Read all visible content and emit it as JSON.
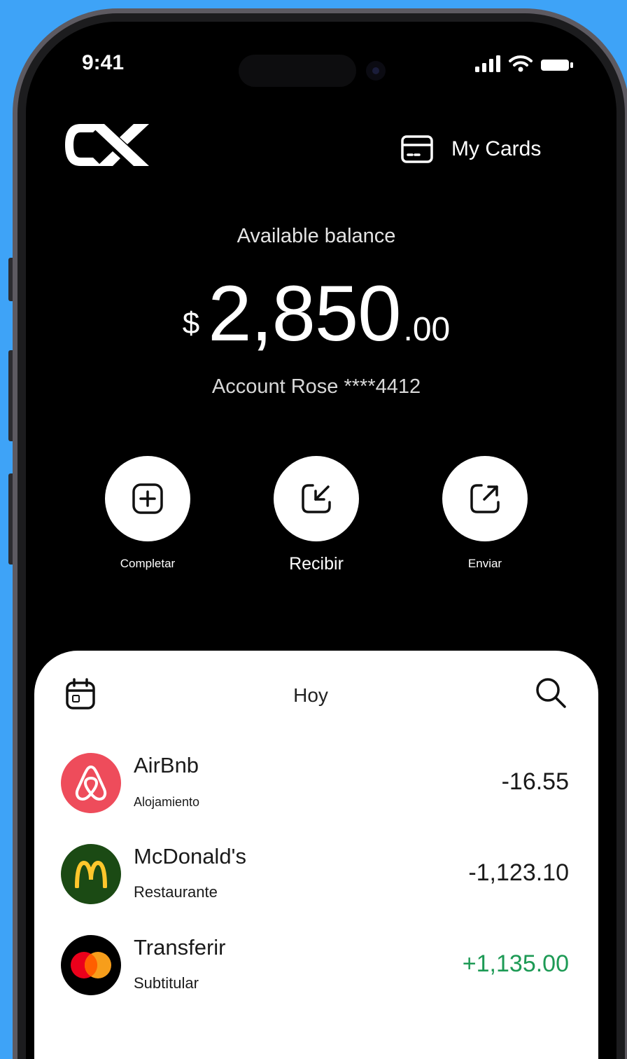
{
  "status_bar": {
    "time": "9:41"
  },
  "header": {
    "my_cards_label": "My Cards"
  },
  "balance": {
    "label": "Available balance",
    "currency": "$",
    "whole": "2,850",
    "decimal": ".00",
    "account": "Account Rose ****4412"
  },
  "actions": [
    {
      "label": "Completar",
      "icon": "plus-square-icon"
    },
    {
      "label": "Recibir",
      "icon": "receive-arrow-icon"
    },
    {
      "label": "Enviar",
      "icon": "send-arrow-icon"
    }
  ],
  "transactions_panel": {
    "title": "Hoy",
    "items": [
      {
        "name": "AirBnb",
        "category": "Alojamiento",
        "amount": "-16.55",
        "icon": "airbnb-logo-icon",
        "color": "#ee4c5b"
      },
      {
        "name": "McDonald's",
        "category": "Restaurante",
        "amount": "-1,123.10",
        "icon": "mcdonalds-logo-icon",
        "color": "#1b4a14"
      },
      {
        "name": "Transferir",
        "category": "Subtitular",
        "amount": "+1,135.00",
        "icon": "mastercard-logo-icon",
        "color": "#000000"
      }
    ]
  },
  "colors": {
    "background": "#3ea3f7",
    "positive_amount": "#1d9a55",
    "screen": "#000000",
    "panel": "#ffffff"
  }
}
